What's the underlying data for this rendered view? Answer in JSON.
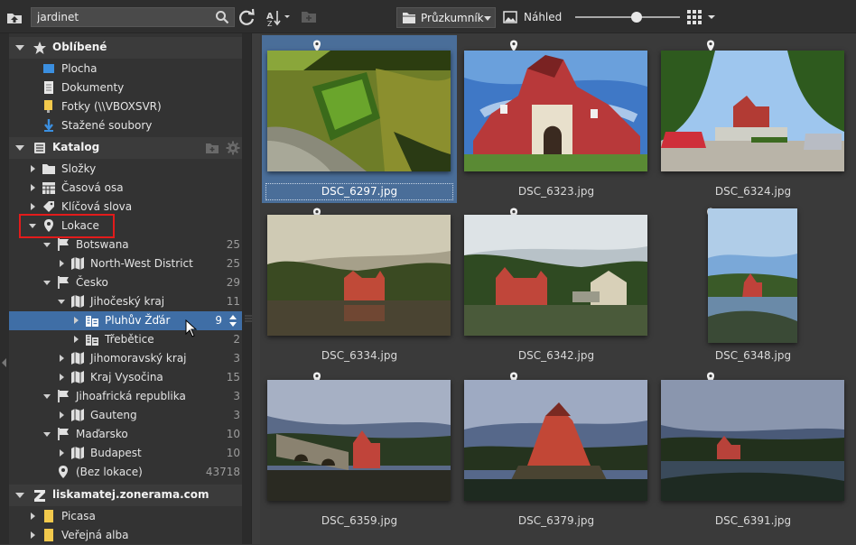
{
  "toolbar": {
    "search_value": "jardinet",
    "explorer_label": "Průzkumník",
    "preview_label": "Náhled",
    "zoom_level": 0.6
  },
  "sidebar": {
    "favorites": {
      "title": "Oblíbené",
      "items": [
        {
          "label": "Plocha",
          "icon": "desktop-icon"
        },
        {
          "label": "Dokumenty",
          "icon": "documents-icon"
        },
        {
          "label": "Fotky (\\\\VBOXSVR)",
          "icon": "network-folder-icon"
        },
        {
          "label": "Stažené soubory",
          "icon": "download-icon"
        }
      ]
    },
    "catalog": {
      "title": "Katalog",
      "items": [
        {
          "label": "Složky"
        },
        {
          "label": "Časová osa"
        },
        {
          "label": "Klíčová slova"
        },
        {
          "label": "Lokace"
        }
      ],
      "locations": [
        {
          "label": "Botswana",
          "count": "25"
        },
        {
          "label": "North-West District",
          "count": "25"
        },
        {
          "label": "Česko",
          "count": "29"
        },
        {
          "label": "Jihočeský kraj",
          "count": "11"
        },
        {
          "label": "Pluhův Žďár",
          "count": "9"
        },
        {
          "label": "Třebětice",
          "count": "2"
        },
        {
          "label": "Jihomoravský kraj",
          "count": "3"
        },
        {
          "label": "Kraj Vysočina",
          "count": "15"
        },
        {
          "label": "Jihoafrická republika",
          "count": "3"
        },
        {
          "label": "Gauteng",
          "count": "3"
        },
        {
          "label": "Maďarsko",
          "count": "10"
        },
        {
          "label": "Budapest",
          "count": "10"
        },
        {
          "label": "(Bez lokace)",
          "count": "43718"
        }
      ]
    },
    "zonerama": {
      "title": "liskamatej.zonerama.com",
      "items": [
        {
          "label": "Picasa"
        },
        {
          "label": "Veřejná alba"
        }
      ]
    }
  },
  "thumbnails": [
    {
      "filename": "DSC_6297.jpg",
      "selected": true
    },
    {
      "filename": "DSC_6323.jpg"
    },
    {
      "filename": "DSC_6324.jpg"
    },
    {
      "filename": "DSC_6334.jpg"
    },
    {
      "filename": "DSC_6342.jpg"
    },
    {
      "filename": "DSC_6348.jpg"
    },
    {
      "filename": "DSC_6359.jpg"
    },
    {
      "filename": "DSC_6379.jpg"
    },
    {
      "filename": "DSC_6391.jpg"
    }
  ],
  "colors": {
    "selection": "#3f6ea6",
    "highlight": "#e31b1b",
    "panel": "#333333"
  }
}
